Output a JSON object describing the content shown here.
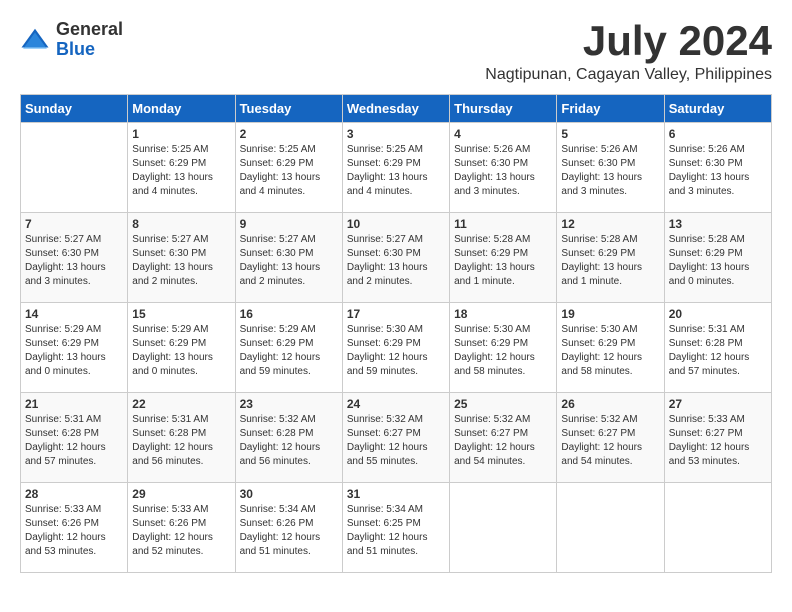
{
  "logo": {
    "general": "General",
    "blue": "Blue"
  },
  "title": {
    "month": "July 2024",
    "location": "Nagtipunan, Cagayan Valley, Philippines"
  },
  "headers": [
    "Sunday",
    "Monday",
    "Tuesday",
    "Wednesday",
    "Thursday",
    "Friday",
    "Saturday"
  ],
  "weeks": [
    [
      {
        "day": "",
        "info": ""
      },
      {
        "day": "1",
        "info": "Sunrise: 5:25 AM\nSunset: 6:29 PM\nDaylight: 13 hours and 4 minutes."
      },
      {
        "day": "2",
        "info": "Sunrise: 5:25 AM\nSunset: 6:29 PM\nDaylight: 13 hours and 4 minutes."
      },
      {
        "day": "3",
        "info": "Sunrise: 5:25 AM\nSunset: 6:29 PM\nDaylight: 13 hours and 4 minutes."
      },
      {
        "day": "4",
        "info": "Sunrise: 5:26 AM\nSunset: 6:30 PM\nDaylight: 13 hours and 3 minutes."
      },
      {
        "day": "5",
        "info": "Sunrise: 5:26 AM\nSunset: 6:30 PM\nDaylight: 13 hours and 3 minutes."
      },
      {
        "day": "6",
        "info": "Sunrise: 5:26 AM\nSunset: 6:30 PM\nDaylight: 13 hours and 3 minutes."
      }
    ],
    [
      {
        "day": "7",
        "info": "Sunrise: 5:27 AM\nSunset: 6:30 PM\nDaylight: 13 hours and 3 minutes."
      },
      {
        "day": "8",
        "info": "Sunrise: 5:27 AM\nSunset: 6:30 PM\nDaylight: 13 hours and 2 minutes."
      },
      {
        "day": "9",
        "info": "Sunrise: 5:27 AM\nSunset: 6:30 PM\nDaylight: 13 hours and 2 minutes."
      },
      {
        "day": "10",
        "info": "Sunrise: 5:27 AM\nSunset: 6:30 PM\nDaylight: 13 hours and 2 minutes."
      },
      {
        "day": "11",
        "info": "Sunrise: 5:28 AM\nSunset: 6:29 PM\nDaylight: 13 hours and 1 minute."
      },
      {
        "day": "12",
        "info": "Sunrise: 5:28 AM\nSunset: 6:29 PM\nDaylight: 13 hours and 1 minute."
      },
      {
        "day": "13",
        "info": "Sunrise: 5:28 AM\nSunset: 6:29 PM\nDaylight: 13 hours and 0 minutes."
      }
    ],
    [
      {
        "day": "14",
        "info": "Sunrise: 5:29 AM\nSunset: 6:29 PM\nDaylight: 13 hours and 0 minutes."
      },
      {
        "day": "15",
        "info": "Sunrise: 5:29 AM\nSunset: 6:29 PM\nDaylight: 13 hours and 0 minutes."
      },
      {
        "day": "16",
        "info": "Sunrise: 5:29 AM\nSunset: 6:29 PM\nDaylight: 12 hours and 59 minutes."
      },
      {
        "day": "17",
        "info": "Sunrise: 5:30 AM\nSunset: 6:29 PM\nDaylight: 12 hours and 59 minutes."
      },
      {
        "day": "18",
        "info": "Sunrise: 5:30 AM\nSunset: 6:29 PM\nDaylight: 12 hours and 58 minutes."
      },
      {
        "day": "19",
        "info": "Sunrise: 5:30 AM\nSunset: 6:29 PM\nDaylight: 12 hours and 58 minutes."
      },
      {
        "day": "20",
        "info": "Sunrise: 5:31 AM\nSunset: 6:28 PM\nDaylight: 12 hours and 57 minutes."
      }
    ],
    [
      {
        "day": "21",
        "info": "Sunrise: 5:31 AM\nSunset: 6:28 PM\nDaylight: 12 hours and 57 minutes."
      },
      {
        "day": "22",
        "info": "Sunrise: 5:31 AM\nSunset: 6:28 PM\nDaylight: 12 hours and 56 minutes."
      },
      {
        "day": "23",
        "info": "Sunrise: 5:32 AM\nSunset: 6:28 PM\nDaylight: 12 hours and 56 minutes."
      },
      {
        "day": "24",
        "info": "Sunrise: 5:32 AM\nSunset: 6:27 PM\nDaylight: 12 hours and 55 minutes."
      },
      {
        "day": "25",
        "info": "Sunrise: 5:32 AM\nSunset: 6:27 PM\nDaylight: 12 hours and 54 minutes."
      },
      {
        "day": "26",
        "info": "Sunrise: 5:32 AM\nSunset: 6:27 PM\nDaylight: 12 hours and 54 minutes."
      },
      {
        "day": "27",
        "info": "Sunrise: 5:33 AM\nSunset: 6:27 PM\nDaylight: 12 hours and 53 minutes."
      }
    ],
    [
      {
        "day": "28",
        "info": "Sunrise: 5:33 AM\nSunset: 6:26 PM\nDaylight: 12 hours and 53 minutes."
      },
      {
        "day": "29",
        "info": "Sunrise: 5:33 AM\nSunset: 6:26 PM\nDaylight: 12 hours and 52 minutes."
      },
      {
        "day": "30",
        "info": "Sunrise: 5:34 AM\nSunset: 6:26 PM\nDaylight: 12 hours and 51 minutes."
      },
      {
        "day": "31",
        "info": "Sunrise: 5:34 AM\nSunset: 6:25 PM\nDaylight: 12 hours and 51 minutes."
      },
      {
        "day": "",
        "info": ""
      },
      {
        "day": "",
        "info": ""
      },
      {
        "day": "",
        "info": ""
      }
    ]
  ]
}
